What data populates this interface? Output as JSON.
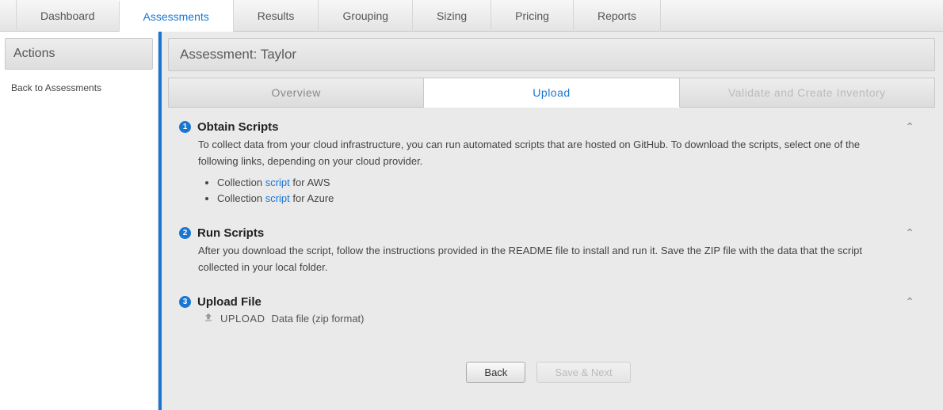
{
  "topnav": {
    "items": [
      {
        "label": "Dashboard"
      },
      {
        "label": "Assessments"
      },
      {
        "label": "Results"
      },
      {
        "label": "Grouping"
      },
      {
        "label": "Sizing"
      },
      {
        "label": "Pricing"
      },
      {
        "label": "Reports"
      }
    ]
  },
  "sidebar": {
    "title": "Actions",
    "back": "Back to Assessments"
  },
  "page": {
    "title": "Assessment: Taylor"
  },
  "subtabs": {
    "overview": "Overview",
    "upload": "Upload",
    "validate": "Validate and Create Inventory"
  },
  "steps": {
    "s1": {
      "num": "1",
      "title": "Obtain Scripts",
      "body": "To collect data from your cloud infrastructure, you can run automated scripts that are hosted on GitHub. To download the scripts, select one of the following links, depending on your cloud provider.",
      "li1a": "Collection ",
      "li1link": "script",
      "li1b": " for AWS",
      "li2a": "Collection ",
      "li2link": "script",
      "li2b": " for Azure"
    },
    "s2": {
      "num": "2",
      "title": "Run Scripts",
      "body": "After you download the script, follow the instructions provided in the README file to install and run it. Save the ZIP file with the data that the script collected in your local folder."
    },
    "s3": {
      "num": "3",
      "title": "Upload File",
      "upload_label": "UPLOAD",
      "upload_desc": "Data file (zip format)"
    }
  },
  "buttons": {
    "back": "Back",
    "save_next": "Save & Next"
  },
  "chevron": "⌃"
}
